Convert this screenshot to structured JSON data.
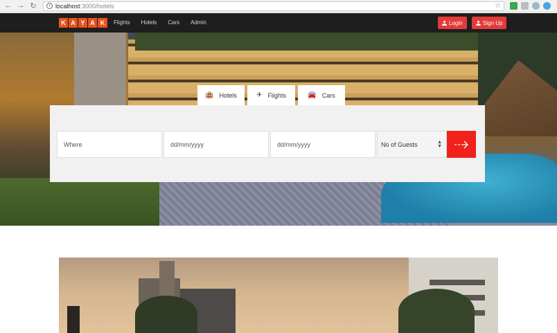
{
  "browser": {
    "url_host": "localhost",
    "url_path": ":3000/hotels"
  },
  "header": {
    "logo_letters": [
      "K",
      "A",
      "Y",
      "A",
      "K"
    ],
    "nav": [
      "Flights",
      "Hotels",
      "Cars",
      "Admin"
    ],
    "login_label": "Login",
    "signup_label": "Sign Up"
  },
  "search": {
    "tabs": [
      {
        "label": "Hotels",
        "icon": "hotel-icon"
      },
      {
        "label": "Flights",
        "icon": "plane-icon"
      },
      {
        "label": "Cars",
        "icon": "car-icon"
      }
    ],
    "where_placeholder": "Where",
    "checkin_placeholder": "dd/mm/yyyy",
    "checkout_placeholder": "dd/mm/yyyy",
    "guests_selected": "No of Guests"
  },
  "colors": {
    "brand": "#e8521e",
    "accent": "#f0211b",
    "nav_bg": "#1e1e1e"
  }
}
